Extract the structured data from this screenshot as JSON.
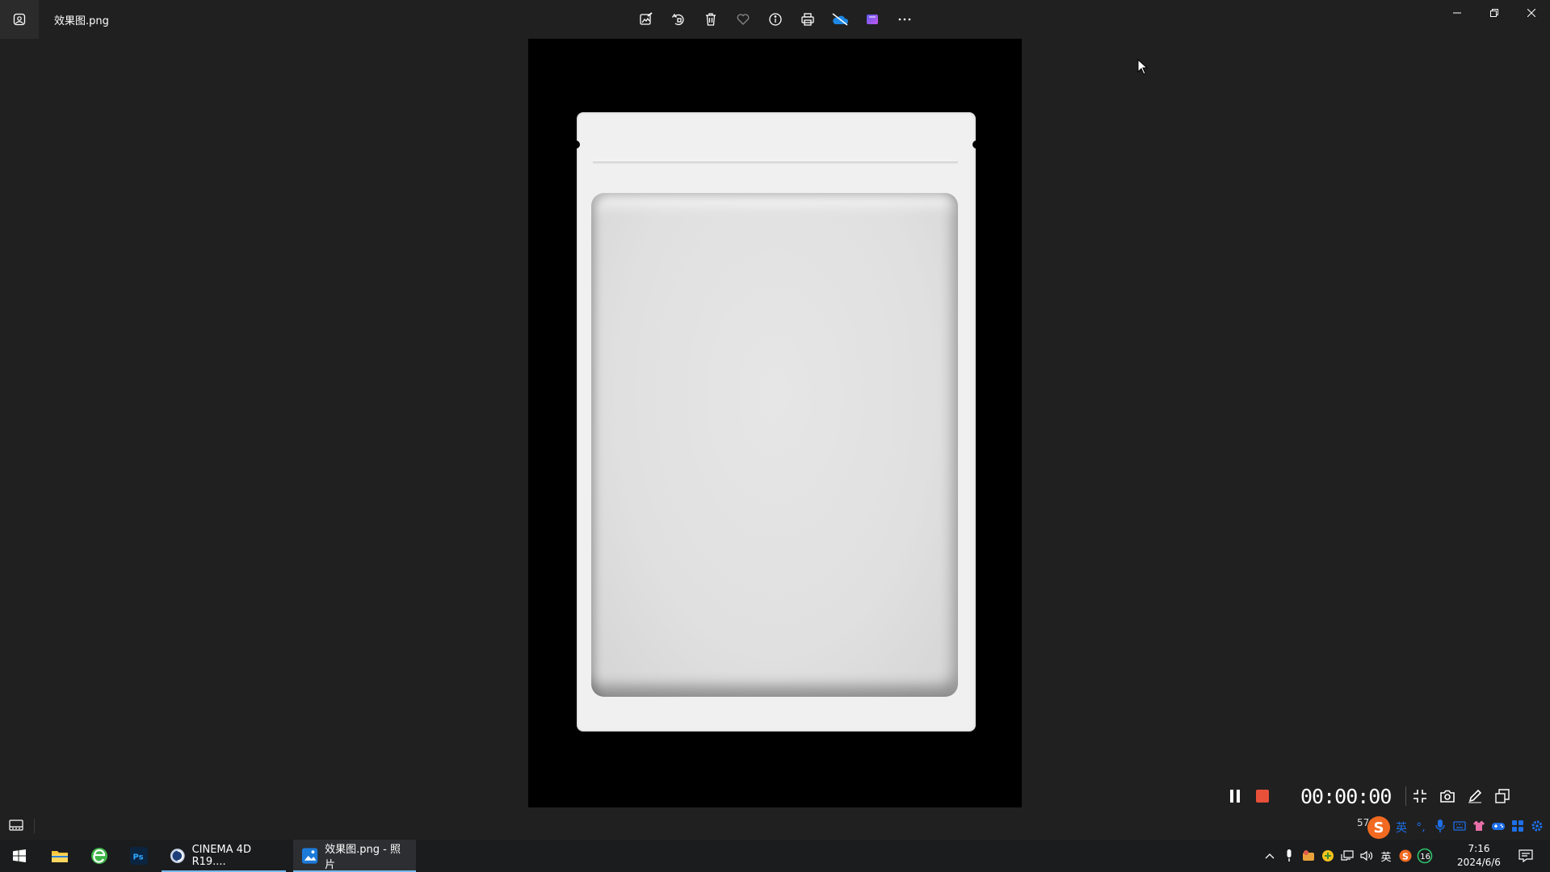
{
  "window": {
    "title": "效果图.png",
    "toolbar": [
      {
        "name": "edit-image-icon"
      },
      {
        "name": "rotate-icon"
      },
      {
        "name": "delete-icon"
      },
      {
        "name": "favorite-icon"
      },
      {
        "name": "info-icon"
      },
      {
        "name": "print-icon"
      },
      {
        "name": "onedrive-icon"
      },
      {
        "name": "clipchamp-icon"
      },
      {
        "name": "more-icon"
      }
    ]
  },
  "recorder": {
    "timer": "00:00:00",
    "stop_color": "#e8503a"
  },
  "status": {
    "zoom": "57"
  },
  "ime": {
    "logo": "S",
    "mode": "英",
    "punct": "°,"
  },
  "taskbar": {
    "apps": [
      {
        "label": "CINEMA 4D R19...."
      },
      {
        "label": "效果图.png - 照片"
      }
    ],
    "tray": {
      "ime": "英",
      "badge": "16"
    },
    "clock": {
      "time": "7:16",
      "date": "2024/6/6"
    }
  }
}
